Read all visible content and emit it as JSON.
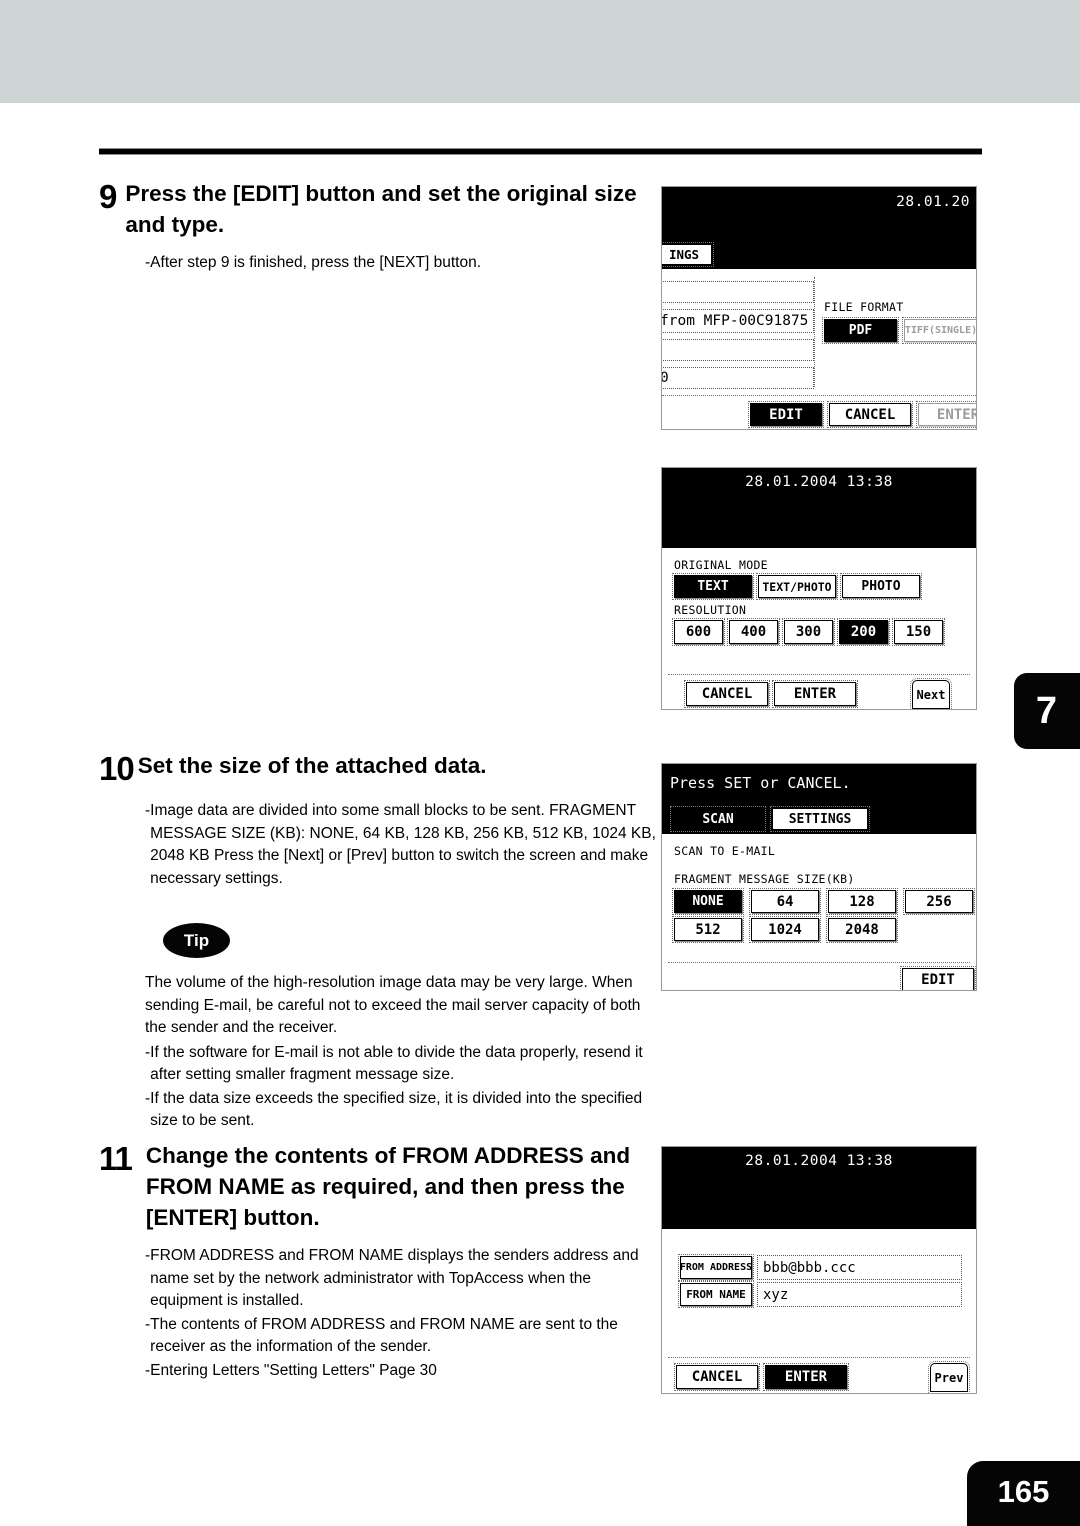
{
  "page": {
    "number": "165",
    "chapter_tab": "7"
  },
  "steps": [
    {
      "number": "9",
      "title": "Press the [EDIT] button and set the original size and type.",
      "bullets": [
        "After step 9 is finished, press the [NEXT] button."
      ]
    },
    {
      "number": "10",
      "title": "Set the size of the attached data.",
      "bullets": [
        "Image data are divided into some small blocks to be sent. FRAGMENT MESSAGE SIZE (KB): NONE, 64 KB, 128 KB, 256 KB, 512 KB, 1024 KB, 2048 KB Press the [Next] or [Prev] button to switch the screen and make necessary settings."
      ]
    },
    {
      "number": "11",
      "title": "Change the contents of FROM ADDRESS and FROM NAME as required, and then press the [ENTER] button.",
      "bullets": [
        "FROM ADDRESS and FROM NAME displays the senders address and name set by the network administrator with TopAccess when the equipment is installed.",
        "The contents of FROM ADDRESS and FROM NAME are sent to the receiver as the information of the sender.",
        "Entering Letters \"Setting Letters\"  Page 30"
      ]
    }
  ],
  "tip": {
    "badge_label": "Tip",
    "paragraph": "The volume of the high-resolution image data may be very large. When sending E-mail, be careful not to exceed the mail server capacity of both the sender and the receiver.",
    "bullets": [
      "If the software for E-mail is not able to divide the data properly, resend it after setting smaller fragment message size.",
      "If the data size exceeds the specified size, it is divided into the specified size to be sent."
    ]
  },
  "lcd_panels": {
    "panel1": {
      "clock": "28.01.20",
      "tab_label": "INGS",
      "field_value": "from MFP-00C91875",
      "field_value_partial": "0",
      "file_format_label": "FILE FORMAT",
      "format_buttons": [
        {
          "label": "PDF",
          "state": "selected"
        },
        {
          "label": "TIFF(SINGLE)",
          "state": "disabled"
        }
      ],
      "action_buttons": [
        {
          "label": "EDIT",
          "state": "selected"
        },
        {
          "label": "CANCEL",
          "state": "normal"
        },
        {
          "label": "ENTER",
          "state": "disabled"
        }
      ]
    },
    "panel2": {
      "clock": "28.01.2004 13:38",
      "original_mode_label": "ORIGINAL MODE",
      "original_mode_buttons": [
        {
          "label": "TEXT",
          "state": "selected"
        },
        {
          "label": "TEXT/PHOTO",
          "state": "normal"
        },
        {
          "label": "PHOTO",
          "state": "normal"
        }
      ],
      "resolution_label": "RESOLUTION",
      "resolution_buttons": [
        {
          "label": "600",
          "state": "normal"
        },
        {
          "label": "400",
          "state": "normal"
        },
        {
          "label": "300",
          "state": "normal"
        },
        {
          "label": "200",
          "state": "selected"
        },
        {
          "label": "150",
          "state": "normal"
        }
      ],
      "action_buttons": [
        {
          "label": "CANCEL",
          "state": "normal"
        },
        {
          "label": "ENTER",
          "state": "normal"
        }
      ],
      "nav_button": "Next"
    },
    "panel3": {
      "prompt": "Press SET or CANCEL.",
      "tabs": [
        {
          "label": "SCAN",
          "state": "selected"
        },
        {
          "label": "SETTINGS",
          "state": "normal"
        }
      ],
      "mode_label": "SCAN TO E-MAIL",
      "fragment_label": "FRAGMENT MESSAGE SIZE(KB)",
      "fragment_buttons": [
        {
          "label": "NONE",
          "state": "selected"
        },
        {
          "label": "64",
          "state": "normal"
        },
        {
          "label": "128",
          "state": "normal"
        },
        {
          "label": "256",
          "state": "normal"
        },
        {
          "label": "512",
          "state": "normal"
        },
        {
          "label": "1024",
          "state": "normal"
        },
        {
          "label": "2048",
          "state": "normal"
        }
      ],
      "edit_button": "EDIT"
    },
    "panel4": {
      "clock": "28.01.2004 13:38",
      "rows": [
        {
          "label": "FROM ADDRESS",
          "value": "bbb@bbb.ccc"
        },
        {
          "label": "FROM NAME",
          "value": "xyz"
        }
      ],
      "action_buttons": [
        {
          "label": "CANCEL",
          "state": "normal"
        },
        {
          "label": "ENTER",
          "state": "selected"
        }
      ],
      "nav_button": "Prev"
    }
  },
  "colors": {
    "header_band": "#ced6d5",
    "ink": "#000000",
    "badge_bg": "#050505"
  }
}
